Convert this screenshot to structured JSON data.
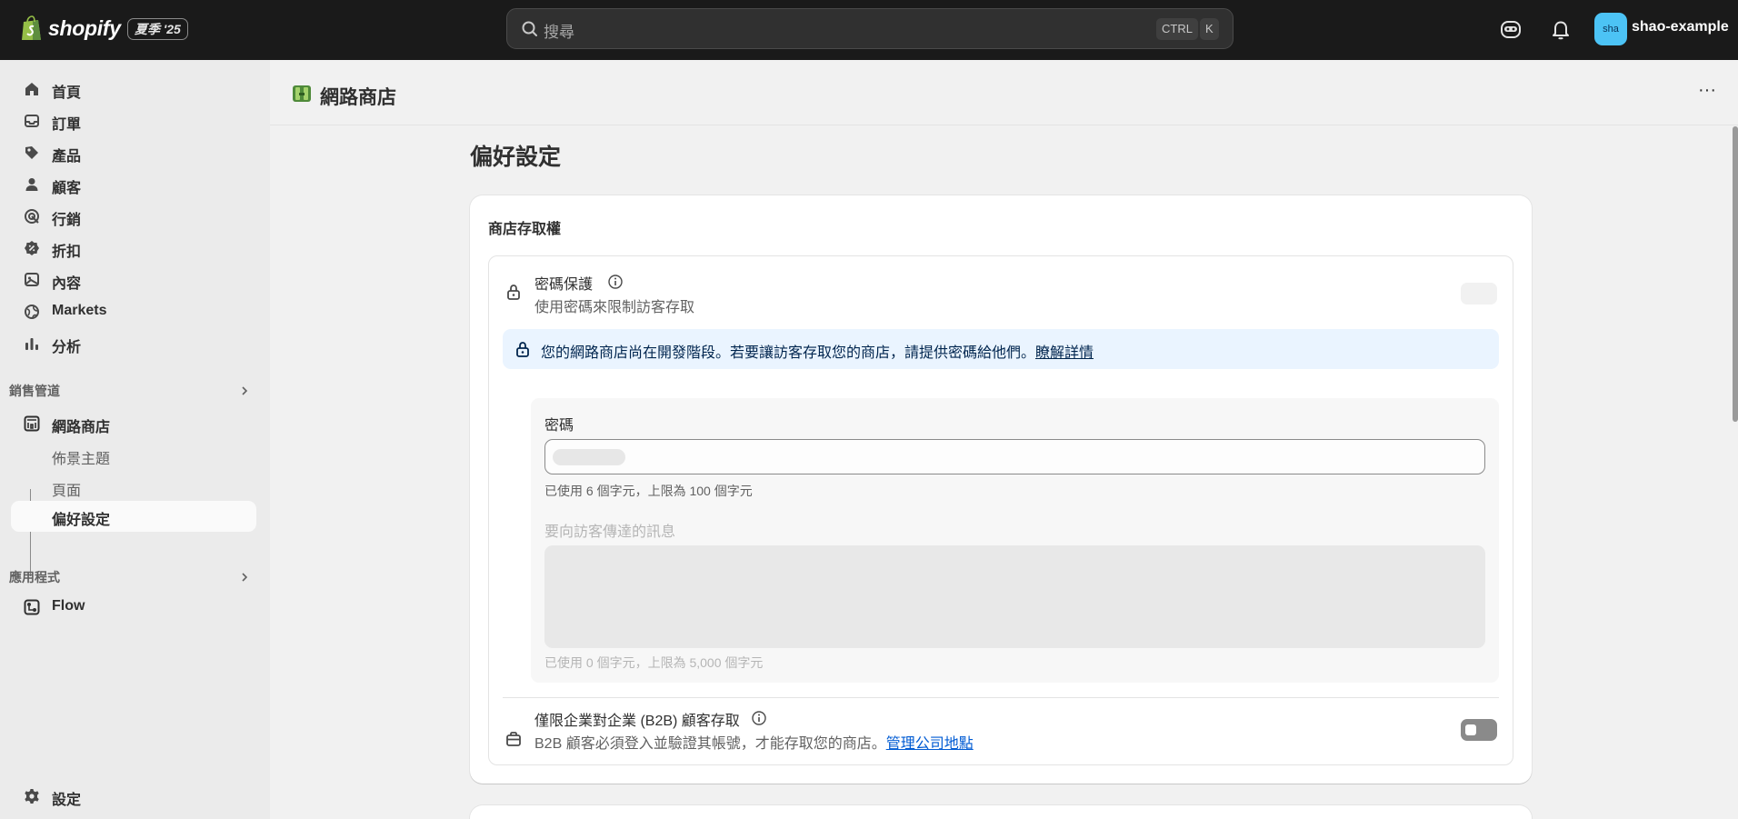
{
  "topbar": {
    "brand": "shopify",
    "season_badge": "夏季 '25",
    "search_placeholder": "搜尋",
    "kbd_ctrl": "CTRL",
    "kbd_k": "K",
    "avatar_initials": "sha",
    "store_name": "shao-example",
    "colors": {
      "bar_bg": "#1a1a1a",
      "avatar_bg": "#4cc3f5"
    }
  },
  "sidebar": {
    "items": [
      {
        "label": "首頁",
        "icon": "home-icon"
      },
      {
        "label": "訂單",
        "icon": "inbox-icon"
      },
      {
        "label": "產品",
        "icon": "tag-icon"
      },
      {
        "label": "顧客",
        "icon": "person-icon"
      },
      {
        "label": "行銷",
        "icon": "target-icon"
      },
      {
        "label": "折扣",
        "icon": "discount-icon"
      },
      {
        "label": "內容",
        "icon": "image-icon"
      },
      {
        "label": "Markets",
        "icon": "globe-icon"
      },
      {
        "label": "分析",
        "icon": "bar-chart-icon"
      }
    ],
    "sales_channels_label": "銷售管道",
    "online_store": {
      "label": "網路商店",
      "sub": [
        {
          "label": "佈景主題"
        },
        {
          "label": "頁面"
        },
        {
          "label": "偏好設定",
          "active": true
        }
      ]
    },
    "apps_label": "應用程式",
    "apps": [
      {
        "label": "Flow",
        "icon": "flow-icon"
      }
    ],
    "settings_label": "設定"
  },
  "header": {
    "title": "網路商店",
    "more": "···"
  },
  "main": {
    "page_title": "偏好設定",
    "card": {
      "title": "商店存取權",
      "password_protection": {
        "title": "密碼保護",
        "description": "使用密碼來限制訪客存取",
        "toggle_on": false
      },
      "banner": {
        "text": "您的網路商店尚在開發階段。若要讓訪客存取您的商店，請提供密碼給他們。",
        "link": "瞭解詳情"
      },
      "password_field": {
        "label": "密碼",
        "help": "已使用 6 個字元，上限為 100 個字元"
      },
      "message_field": {
        "label": "要向訪客傳達的訊息",
        "help": "已使用 0 個字元，上限為 5,000 個字元"
      },
      "b2b": {
        "title": "僅限企業對企業 (B2B) 顧客存取",
        "description": "B2B 顧客必須登入並驗證其帳號，才能存取您的商店。",
        "link": "管理公司地點",
        "toggle_on": false
      }
    }
  }
}
